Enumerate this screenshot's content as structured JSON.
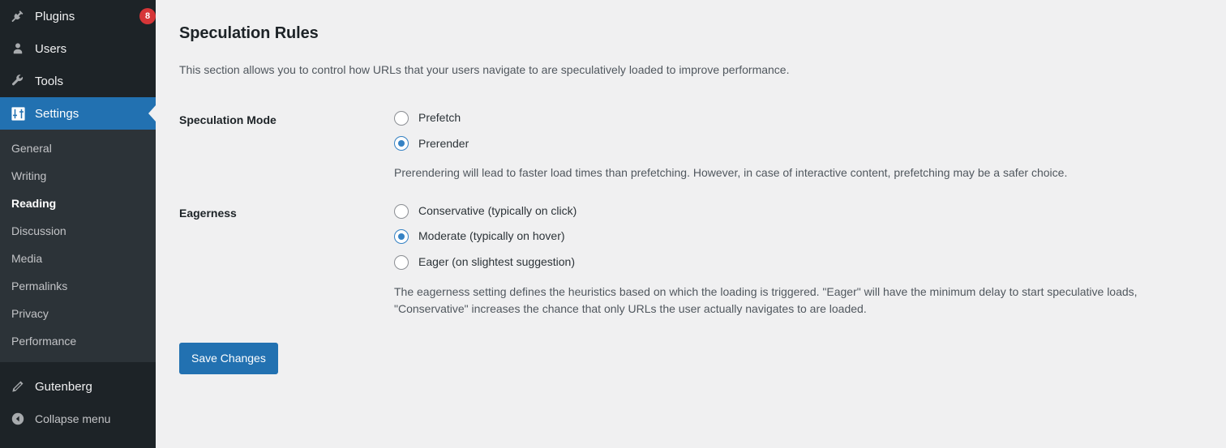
{
  "sidebar": {
    "top_items": [
      {
        "label": "Plugins",
        "icon": "plugin-icon",
        "badge": "8",
        "current": false
      },
      {
        "label": "Users",
        "icon": "user-icon",
        "badge": "",
        "current": false
      },
      {
        "label": "Tools",
        "icon": "wrench-icon",
        "badge": "",
        "current": false
      },
      {
        "label": "Settings",
        "icon": "settings-sliders-icon",
        "badge": "",
        "current": true
      }
    ],
    "submenu": [
      {
        "label": "General",
        "current": false
      },
      {
        "label": "Writing",
        "current": false
      },
      {
        "label": "Reading",
        "current": true
      },
      {
        "label": "Discussion",
        "current": false
      },
      {
        "label": "Media",
        "current": false
      },
      {
        "label": "Permalinks",
        "current": false
      },
      {
        "label": "Privacy",
        "current": false
      },
      {
        "label": "Performance",
        "current": false
      }
    ],
    "bottom_items": [
      {
        "label": "Gutenberg",
        "icon": "pencil-icon"
      }
    ],
    "collapse": {
      "label": "Collapse menu",
      "icon": "collapse-arrow-icon"
    },
    "colors": {
      "background": "#1d2327",
      "submenu_background": "#2c3338",
      "current_highlight": "#2271b1",
      "badge": "#d63638"
    }
  },
  "main": {
    "title": "Speculation Rules",
    "description": "This section allows you to control how URLs that your users navigate to are speculatively loaded to improve performance.",
    "fields": [
      {
        "label": "Speculation Mode",
        "options": [
          {
            "label": "Prefetch",
            "checked": false
          },
          {
            "label": "Prerender",
            "checked": true
          }
        ],
        "description": "Prerendering will lead to faster load times than prefetching. However, in case of interactive content, prefetching may be a safer choice."
      },
      {
        "label": "Eagerness",
        "options": [
          {
            "label": "Conservative (typically on click)",
            "checked": false
          },
          {
            "label": "Moderate (typically on hover)",
            "checked": true
          },
          {
            "label": "Eager (on slightest suggestion)",
            "checked": false
          }
        ],
        "description": "The eagerness setting defines the heuristics based on which the loading is triggered. \"Eager\" will have the minimum delay to start speculative loads, \"Conservative\" increases the chance that only URLs the user actually navigates to are loaded."
      }
    ],
    "submit_label": "Save Changes",
    "accent_color": "#2271b1"
  }
}
